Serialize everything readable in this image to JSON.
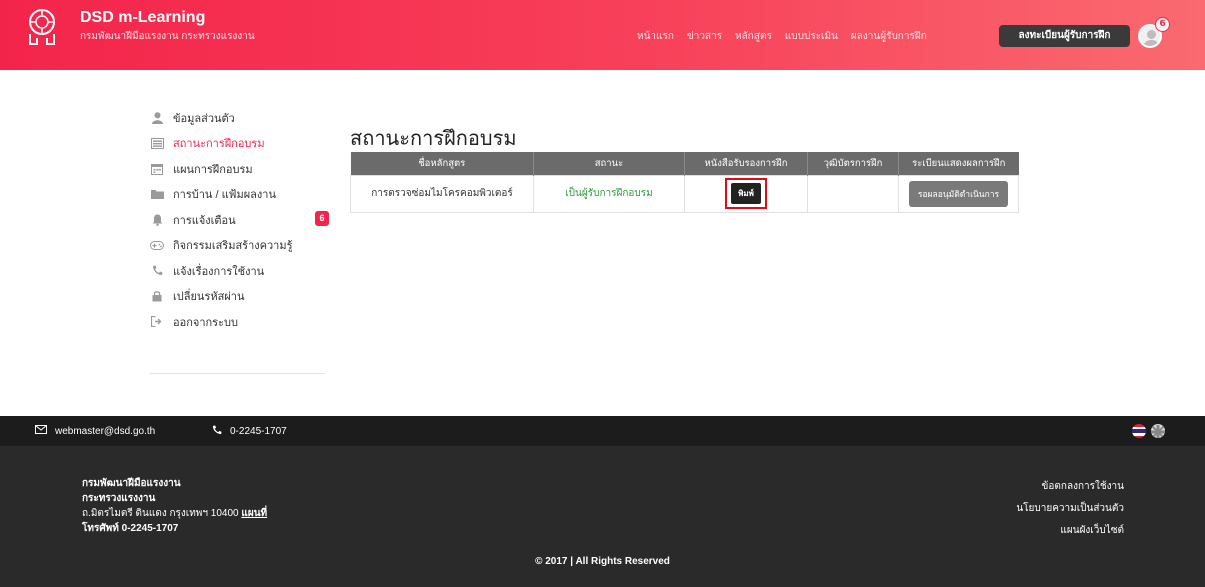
{
  "header": {
    "brand_title": "DSD m-Learning",
    "brand_subtitle": "กรมพัฒนาฝีมือแรงงาน กระทรวงแรงงาน",
    "nav": [
      "หน้าแรก",
      "ข่าวสาร",
      "หลักสูตร",
      "แบบประเมิน",
      "ผลงานผู้รับการฝึก"
    ],
    "register_label": "ลงทะเบียนผู้รับการฝึก",
    "notification_count": "6",
    "accent_color": "#f3244a"
  },
  "sidebar": {
    "items": [
      {
        "label": "ข้อมูลส่วนตัว",
        "icon": "user-icon"
      },
      {
        "label": "สถานะการฝึกอบรม",
        "icon": "list-icon",
        "active": true
      },
      {
        "label": "แผนการฝึกอบรม",
        "icon": "calendar-icon"
      },
      {
        "label": "การบ้าน / แฟ้มผลงาน",
        "icon": "folder-icon"
      },
      {
        "label": "การแจ้งเตือน",
        "icon": "bell-icon",
        "badge": "6"
      },
      {
        "label": "กิจกรรมเสริมสร้างความรู้",
        "icon": "gamepad-icon"
      },
      {
        "label": "แจ้งเรื่องการใช้งาน",
        "icon": "phone-icon"
      },
      {
        "label": "เปลี่ยนรหัสผ่าน",
        "icon": "lock-icon"
      },
      {
        "label": "ออกจากระบบ",
        "icon": "sign-out-icon"
      }
    ]
  },
  "main": {
    "title": "สถานะการฝึกอบรม",
    "table": {
      "headers": [
        "ชื่อหลักสูตร",
        "สถานะ",
        "หนังสือรับรองการฝึก",
        "วุฒิบัตรการฝึก",
        "ระเบียนแสดงผลการฝึก"
      ],
      "rows": [
        {
          "course": "การตรวจซ่อมไมโครคอมพิวเตอร์",
          "status": "เป็นผู้รับการฝึกอบรม",
          "certificate_button": "พิมพ์",
          "diploma": "",
          "transcript_button": "รอผลอนุมัติดำเนินการ"
        }
      ]
    }
  },
  "footer": {
    "email": "webmaster@dsd.go.th",
    "phone": "0-2245-1707",
    "org_name": "กรมพัฒนาฝีมือแรงงาน",
    "ministry": "กระทรวงแรงงาน",
    "address": "ถ.มิตรไมตรี ดินแดง กรุงเทพฯ 10400",
    "map_link": "แผนที่",
    "tel": "โทรศัพท์ 0-2245-1707",
    "links": [
      "ข้อตกลงการใช้งาน",
      "นโยบายความเป็นส่วนตัว",
      "แผนผังเว็บไซต์"
    ],
    "copyright": "© 2017 | All Rights Reserved"
  }
}
